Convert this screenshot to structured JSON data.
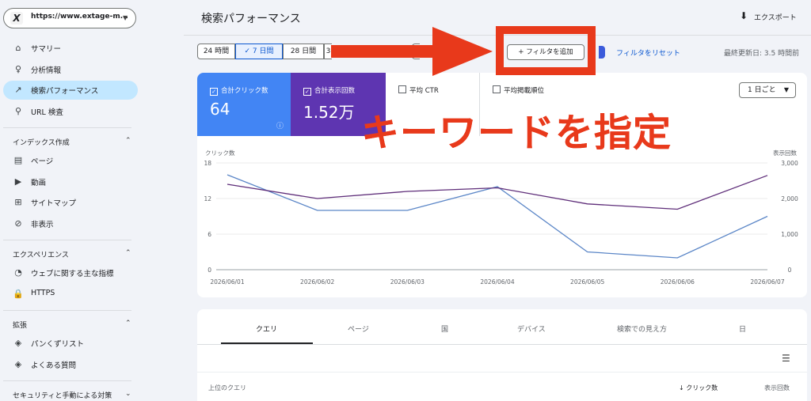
{
  "sidebar": {
    "property": {
      "logo": "X",
      "url": "https://www.extage-m..."
    },
    "items": [
      {
        "icon": "home-icon",
        "glyph": "⌂",
        "label": "サマリー"
      },
      {
        "icon": "lightbulb-icon",
        "glyph": "♀",
        "label": "分析情報"
      },
      {
        "icon": "trending-up-icon",
        "glyph": "↗",
        "label": "検索パフォーマンス",
        "active": true
      },
      {
        "icon": "search-icon",
        "glyph": "⚲",
        "label": "URL 検査"
      }
    ],
    "sections": [
      {
        "title": "インデックス作成",
        "items": [
          {
            "icon": "pages-icon",
            "glyph": "▤",
            "label": "ページ"
          },
          {
            "icon": "video-icon",
            "glyph": "▶",
            "label": "動画"
          },
          {
            "icon": "sitemap-icon",
            "glyph": "⊞",
            "label": "サイトマップ"
          },
          {
            "icon": "hidden-icon",
            "glyph": "⊘",
            "label": "非表示"
          }
        ]
      },
      {
        "title": "エクスペリエンス",
        "items": [
          {
            "icon": "speed-icon",
            "glyph": "◔",
            "label": "ウェブに関する主な指標"
          },
          {
            "icon": "lock-icon",
            "glyph": "🔒",
            "label": "HTTPS"
          }
        ]
      },
      {
        "title": "拡張",
        "items": [
          {
            "icon": "layers-icon",
            "glyph": "◈",
            "label": "パンくずリスト"
          },
          {
            "icon": "layers-icon",
            "glyph": "◈",
            "label": "よくある質問"
          }
        ]
      },
      {
        "title": "セキュリティと手動による対策"
      }
    ]
  },
  "header": {
    "title": "検索パフォーマンス",
    "export": "エクスポート",
    "date_ranges": [
      "24 時間",
      "7 日間",
      "28 日間",
      "3"
    ],
    "selected_range": "7 日間",
    "add_filter": "+ フィルタを追加",
    "reset_filter": "フィルタをリセット",
    "last_updated": "最終更新日: 3.5 時間前"
  },
  "metrics": [
    {
      "label": "合計クリック数",
      "value": "64",
      "checked": true,
      "color": "#4285f4"
    },
    {
      "label": "合計表示回数",
      "value": "1.52万",
      "checked": true,
      "color": "#5e35b1"
    },
    {
      "label": "平均 CTR",
      "value": "",
      "checked": false
    },
    {
      "label": "平均掲載順位",
      "value": "",
      "checked": false
    }
  ],
  "per_day": "1 日ごと",
  "chart_data": {
    "type": "line",
    "x": [
      "2026/06/01",
      "2026/06/02",
      "2026/06/03",
      "2026/06/04",
      "2026/06/05",
      "2026/06/06",
      "2026/06/07"
    ],
    "series": [
      {
        "name": "クリック数",
        "axis": "left",
        "color": "#5b86c7",
        "values": [
          16,
          10,
          10,
          14,
          3,
          2,
          9
        ]
      },
      {
        "name": "表示回数",
        "axis": "right",
        "color": "#5e2d79",
        "values": [
          2400,
          2000,
          2200,
          2300,
          1850,
          1700,
          2650
        ]
      }
    ],
    "ylabel_left": "クリック数",
    "ylabel_right": "表示回数",
    "yticks_left": [
      "0",
      "6",
      "12",
      "18"
    ],
    "yticks_right": [
      "0",
      "1,000",
      "2,000",
      "3,000"
    ],
    "ylim_left": [
      0,
      18
    ],
    "ylim_right": [
      0,
      3000
    ]
  },
  "tabs": [
    "クエリ",
    "ページ",
    "国",
    "デバイス",
    "検索での見え方",
    "日"
  ],
  "table": {
    "col_query": "上位のクエリ",
    "col_clicks": "↓ クリック数",
    "col_impr": "表示回数"
  },
  "overlay": {
    "text": "キーワードを指定",
    "color": "#e8391b"
  }
}
